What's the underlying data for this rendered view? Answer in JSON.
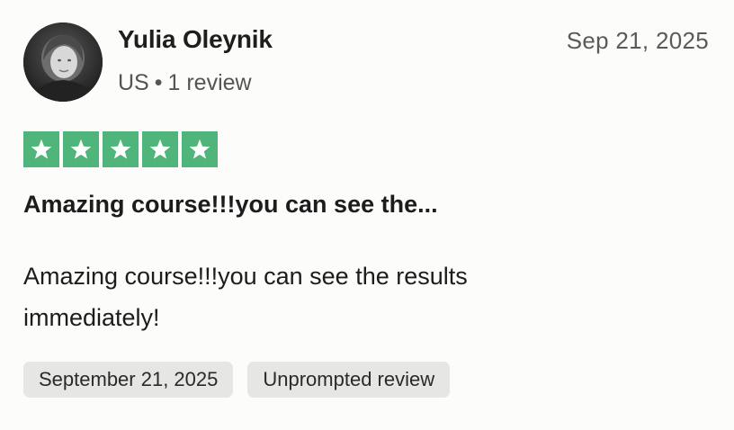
{
  "reviewer": {
    "name": "Yulia Oleynik",
    "country": "US",
    "separator": "•",
    "review_count": "1 review"
  },
  "review": {
    "date": "Sep 21, 2025",
    "rating": 5,
    "rating_max": 5,
    "star_color": "#4fb57a",
    "title": "Amazing course!!!you can see the...",
    "body": "Amazing course!!!you can see the results immediately!"
  },
  "tags": [
    {
      "label": "September 21, 2025"
    },
    {
      "label": "Unprompted review"
    }
  ],
  "icons": {
    "star": "star-icon",
    "avatar": "avatar-photo"
  }
}
